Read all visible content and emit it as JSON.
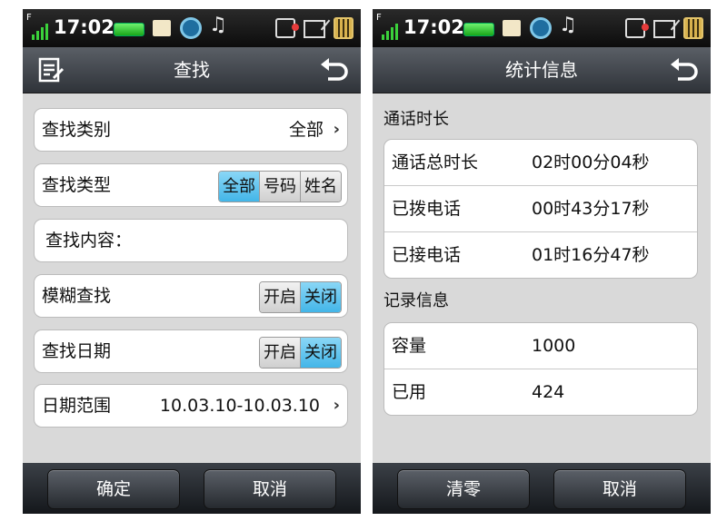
{
  "status": {
    "time": "17:02",
    "network": "F"
  },
  "left": {
    "title": "查找",
    "rows": [
      {
        "label": "查找类别",
        "value": "全部"
      },
      {
        "label": "查找类型",
        "options": [
          "全部",
          "号码",
          "姓名"
        ],
        "selected": "全部"
      },
      {
        "label": "查找内容："
      },
      {
        "label": "模糊查找",
        "options": [
          "开启",
          "关闭"
        ],
        "selected": "关闭"
      },
      {
        "label": "查找日期",
        "options": [
          "开启",
          "关闭"
        ],
        "selected": "关闭"
      },
      {
        "label": "日期范围",
        "value": "10.03.10-10.03.10"
      }
    ],
    "buttons": {
      "confirm": "确定",
      "cancel": "取消"
    }
  },
  "right": {
    "title": "统计信息",
    "section1": {
      "heading": "通话时长",
      "rows": [
        {
          "label": "通话总时长",
          "value": "02时00分04秒"
        },
        {
          "label": "已拨电话",
          "value": "00时43分17秒"
        },
        {
          "label": "已接电话",
          "value": "01时16分47秒"
        }
      ]
    },
    "section2": {
      "heading": "记录信息",
      "rows": [
        {
          "label": "容量",
          "value": "1000"
        },
        {
          "label": "已用",
          "value": "424"
        }
      ]
    },
    "buttons": {
      "clear": "清零",
      "cancel": "取消"
    }
  },
  "colors": {
    "selected_segment": "#43b6e8",
    "battery": "#1aa81a"
  },
  "icons": [
    "signal-icon",
    "battery-icon",
    "message-icon",
    "alarm-icon",
    "music-icon",
    "sim-card-icon",
    "sd-card-icon",
    "storage-icon",
    "menu-icon",
    "back-icon"
  ]
}
